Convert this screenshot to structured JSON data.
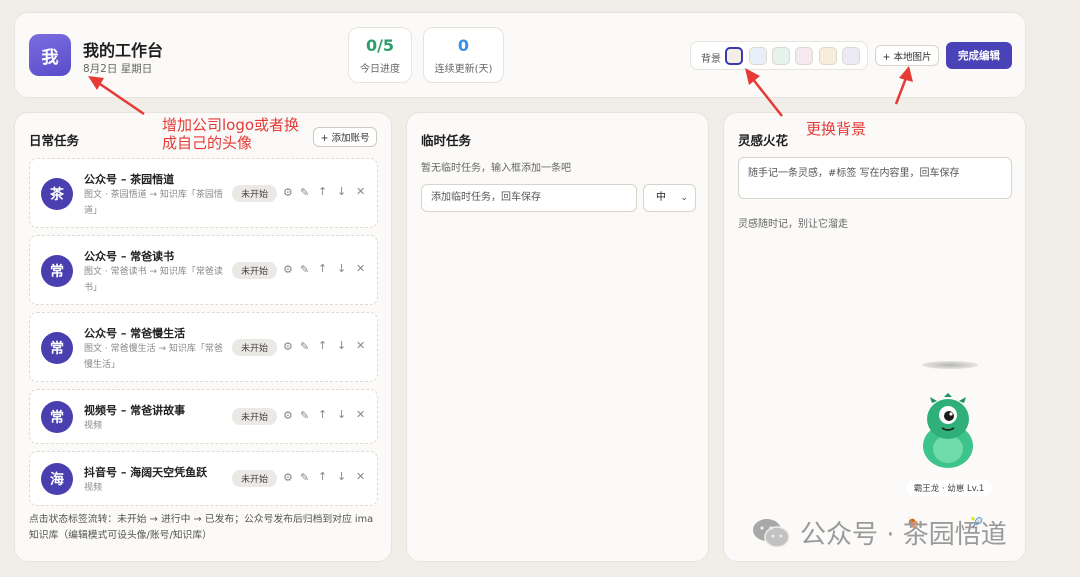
{
  "header": {
    "logo_char": "我",
    "title": "我的工作台",
    "date": "8月2日 星期日",
    "stats": [
      {
        "value": "0/5",
        "label": "今日进度"
      },
      {
        "value": "0",
        "label": "连续更新(天)"
      }
    ],
    "bg_label": "背景",
    "swatch_colors": [
      "#f3efe6",
      "#e8eef9",
      "#e4f3ec",
      "#f6e8ef",
      "#f8ecdb",
      "#ecebf5"
    ],
    "local_image_button": "+ 本地图片",
    "finish_button": "完成编辑"
  },
  "daily": {
    "title": "日常任务",
    "add_account_button": "+ 添加账号",
    "tasks": [
      {
        "avatar": "茶",
        "name": "公众号 – 茶园悟道",
        "desc": "图文 · 茶园悟道 → 知识库「茶园悟道」",
        "status": "未开始"
      },
      {
        "avatar": "常",
        "name": "公众号 – 常爸读书",
        "desc": "图文 · 常爸读书 → 知识库「常爸读书」",
        "status": "未开始"
      },
      {
        "avatar": "常",
        "name": "公众号 – 常爸慢生活",
        "desc": "图文 · 常爸慢生活 → 知识库「常爸慢生活」",
        "status": "未开始"
      },
      {
        "avatar": "常",
        "name": "视频号 – 常爸讲故事",
        "desc": "视频",
        "status": "未开始"
      },
      {
        "avatar": "海",
        "name": "抖音号 – 海阔天空凭鱼跃",
        "desc": "视频",
        "status": "未开始"
      }
    ],
    "footnote": "点击状态标签流转：未开始 → 进行中 → 已发布；公众号发布后归档到对应 ima 知识库（编辑模式可设头像/账号/知识库）"
  },
  "temp": {
    "title": "临时任务",
    "hint": "暂无临时任务，输入框添加一条吧",
    "input_placeholder": "添加临时任务，回车保存",
    "priority_value": "中"
  },
  "idea": {
    "title": "灵感火花",
    "input_placeholder": "随手记一条灵感，#标签 写在内容里，回车保存",
    "hint": "灵感随时记，别让它溜走",
    "pet_label": "霸王龙 · 幼崽 Lv.1"
  },
  "annotations": {
    "logo_note": "增加公司logo或者换成自己的头像",
    "bg_note": "更换背景"
  },
  "watermark": "公众号 · 茶园悟道"
}
